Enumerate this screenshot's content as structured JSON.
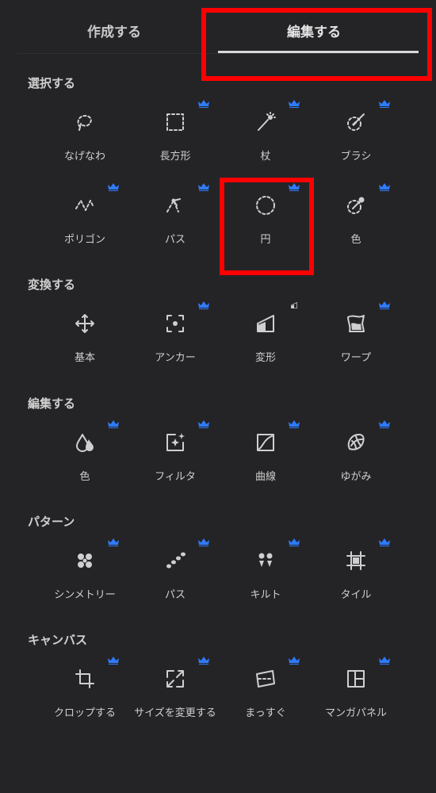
{
  "tabs": {
    "create": "作成する",
    "edit": "編集する"
  },
  "accent": "#2f7bff",
  "highlight": "#ff0000",
  "sections": {
    "select": {
      "title": "選択する",
      "items": [
        {
          "label": "なげなわ",
          "icon": "lasso-icon",
          "premium": false
        },
        {
          "label": "長方形",
          "icon": "rectangle-select-icon",
          "premium": true
        },
        {
          "label": "杖",
          "icon": "magic-wand-icon",
          "premium": true
        },
        {
          "label": "ブラシ",
          "icon": "brush-select-icon",
          "premium": true
        },
        {
          "label": "ポリゴン",
          "icon": "polygon-select-icon",
          "premium": true
        },
        {
          "label": "パス",
          "icon": "path-select-icon",
          "premium": true
        },
        {
          "label": "円",
          "icon": "circle-select-icon",
          "premium": true
        },
        {
          "label": "色",
          "icon": "color-select-icon",
          "premium": true
        }
      ]
    },
    "transform": {
      "title": "変換する",
      "items": [
        {
          "label": "基本",
          "icon": "move-icon",
          "premium": false
        },
        {
          "label": "アンカー",
          "icon": "anchor-icon",
          "premium": true
        },
        {
          "label": "変形",
          "icon": "distort-icon",
          "premium": true
        },
        {
          "label": "ワープ",
          "icon": "warp-icon",
          "premium": true
        }
      ]
    },
    "edit": {
      "title": "編集する",
      "items": [
        {
          "label": "色",
          "icon": "color-drops-icon",
          "premium": true
        },
        {
          "label": "フィルタ",
          "icon": "filter-icon",
          "premium": true
        },
        {
          "label": "曲線",
          "icon": "curves-icon",
          "premium": true
        },
        {
          "label": "ゆがみ",
          "icon": "liquify-icon",
          "premium": true
        }
      ]
    },
    "pattern": {
      "title": "パターン",
      "items": [
        {
          "label": "シンメトリー",
          "icon": "symmetry-icon",
          "premium": true
        },
        {
          "label": "パス",
          "icon": "path-pattern-icon",
          "premium": true
        },
        {
          "label": "キルト",
          "icon": "quilt-icon",
          "premium": true
        },
        {
          "label": "タイル",
          "icon": "tile-icon",
          "premium": true
        }
      ]
    },
    "canvas": {
      "title": "キャンバス",
      "items": [
        {
          "label": "クロップする",
          "icon": "crop-icon",
          "premium": true
        },
        {
          "label": "サイズを変更する",
          "icon": "resize-icon",
          "premium": true
        },
        {
          "label": "まっすぐ",
          "icon": "straighten-icon",
          "premium": true
        },
        {
          "label": "マンガパネル",
          "icon": "manga-panel-icon",
          "premium": true
        }
      ]
    }
  }
}
